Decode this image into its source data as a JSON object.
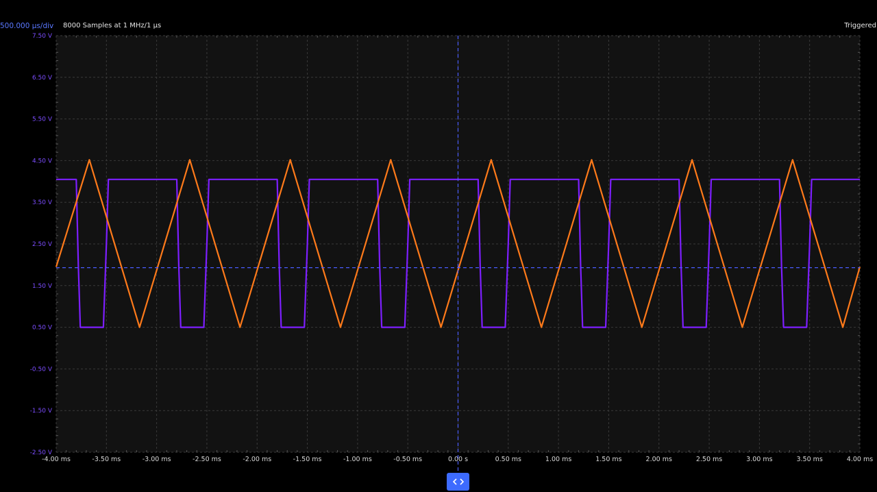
{
  "header": {
    "timebase": "500.000 µs/div",
    "samples": "8000 Samples at 1 MHz/1 µs",
    "trigger_status": "Triggered"
  },
  "colors": {
    "background": "#000000",
    "plot_background": "#121212",
    "grid": "#3a3a3a",
    "cursor": "#4a5cff",
    "axis_label": "#7c4dff",
    "channel_1": "#7d1fff",
    "channel_2": "#ff7a1a",
    "pan_button": "#3d6bff"
  },
  "pan_button": {
    "icon": "chevron-left-right-icon"
  },
  "chart_data": {
    "type": "line",
    "xlim": [
      -4.0,
      4.0
    ],
    "ylim": [
      -2.5,
      7.5
    ],
    "x_ticks": [
      "-4.00 ms",
      "-3.50 ms",
      "-3.00 ms",
      "-2.50 ms",
      "-2.00 ms",
      "-1.50 ms",
      "-1.00 ms",
      "-0.50 ms",
      "0.00 s",
      "0.50 ms",
      "1.00 ms",
      "1.50 ms",
      "2.00 ms",
      "2.50 ms",
      "3.00 ms",
      "3.50 ms",
      "4.00 ms"
    ],
    "y_ticks": [
      "7.50 V",
      "6.50 V",
      "5.50 V",
      "4.50 V",
      "3.50 V",
      "2.50 V",
      "1.50 V",
      "0.50 V",
      "-0.50 V",
      "-1.50 V",
      "-2.50 V"
    ],
    "trigger_level": 1.93,
    "trigger_time": 0.0,
    "series": [
      {
        "channel": "square",
        "color": "#7d1fff",
        "x": [
          -4.0,
          -3.8,
          -3.78,
          -3.76,
          -3.53,
          -3.5,
          -3.48,
          -2.8,
          -2.78,
          -2.76,
          -2.53,
          -2.5,
          -2.48,
          -1.8,
          -1.78,
          -1.76,
          -1.53,
          -1.5,
          -1.48,
          -0.8,
          -0.78,
          -0.76,
          -0.53,
          -0.5,
          -0.48,
          0.2,
          0.22,
          0.24,
          0.47,
          0.5,
          0.52,
          1.2,
          1.22,
          1.24,
          1.47,
          1.5,
          1.52,
          2.2,
          2.22,
          2.24,
          2.47,
          2.5,
          2.52,
          3.2,
          3.22,
          3.24,
          3.47,
          3.5,
          3.52,
          4.0
        ],
        "y": [
          4.05,
          4.05,
          2.0,
          0.5,
          0.5,
          2.5,
          4.05,
          4.05,
          2.0,
          0.5,
          0.5,
          2.5,
          4.05,
          4.05,
          2.0,
          0.5,
          0.5,
          2.5,
          4.05,
          4.05,
          2.0,
          0.5,
          0.5,
          2.5,
          4.05,
          4.05,
          2.0,
          0.5,
          0.5,
          2.5,
          4.05,
          4.05,
          2.0,
          0.5,
          0.5,
          2.5,
          4.05,
          4.05,
          2.0,
          0.5,
          0.5,
          2.5,
          4.05,
          4.05,
          2.0,
          0.5,
          0.5,
          2.5,
          4.05,
          4.05
        ]
      },
      {
        "channel": "triangle",
        "color": "#ff7a1a",
        "x": [
          -4.0,
          -3.67,
          -3.17,
          -2.67,
          -2.17,
          -1.67,
          -1.17,
          -0.67,
          -0.17,
          0.33,
          0.83,
          1.33,
          1.83,
          2.33,
          2.83,
          3.33,
          3.83,
          4.0
        ],
        "y": [
          1.95,
          4.52,
          0.5,
          4.52,
          0.5,
          4.52,
          0.5,
          4.52,
          0.5,
          4.52,
          0.5,
          4.52,
          0.5,
          4.52,
          0.5,
          4.52,
          0.5,
          1.95
        ]
      }
    ]
  }
}
